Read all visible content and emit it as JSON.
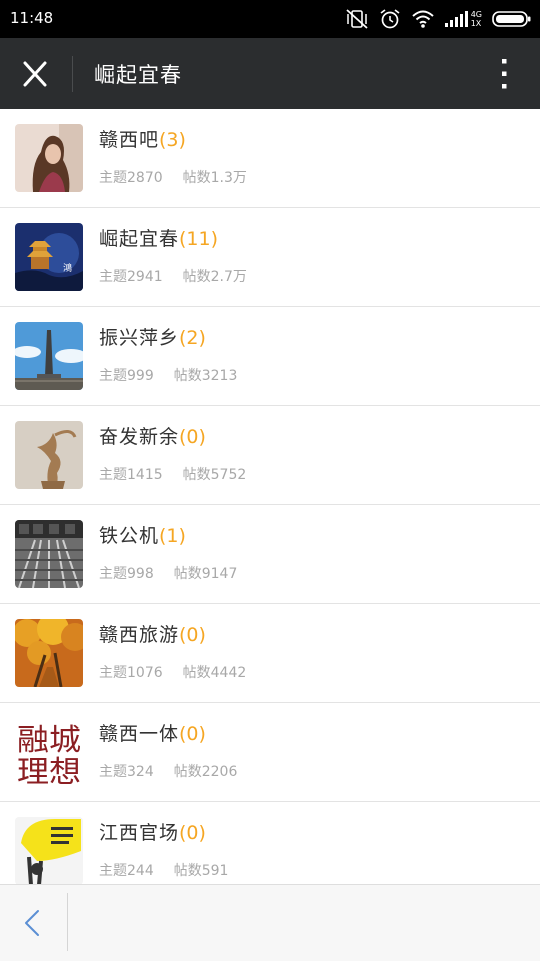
{
  "status_bar": {
    "time": "11:48",
    "network_label_top": "4G",
    "network_label_bottom": "1X",
    "icons": [
      "vibrate-mute-icon",
      "alarm-icon",
      "wifi-icon",
      "signal-icon",
      "battery-icon"
    ]
  },
  "header": {
    "title": "崛起宜春",
    "close_icon": "close-icon",
    "menu_icon": "more-vertical-icon"
  },
  "colors": {
    "title_bar": "#2b2d2f",
    "count_accent": "#f5a623",
    "meta_text": "#a8a8a8"
  },
  "forums": [
    {
      "name": "赣西吧",
      "count": "(3)",
      "topics": "主题2870",
      "posts": "帖数1.3万",
      "thumb": "portrait-photo"
    },
    {
      "name": "崛起宜春",
      "count": "(11)",
      "topics": "主题2941",
      "posts": "帖数2.7万",
      "thumb": "pavilion-night-photo"
    },
    {
      "name": "振兴萍乡",
      "count": "(2)",
      "topics": "主题999",
      "posts": "帖数3213",
      "thumb": "monument-photo"
    },
    {
      "name": "奋发新余",
      "count": "(0)",
      "topics": "主题1415",
      "posts": "帖数5752",
      "thumb": "statue-photo"
    },
    {
      "name": "铁公机",
      "count": "(1)",
      "topics": "主题998",
      "posts": "帖数9147",
      "thumb": "railway-photo"
    },
    {
      "name": "赣西旅游",
      "count": "(0)",
      "topics": "主题1076",
      "posts": "帖数4442",
      "thumb": "autumn-trees-photo"
    },
    {
      "name": "赣西一体",
      "count": "(0)",
      "topics": "主题324",
      "posts": "帖数2206",
      "thumb": "calligraphy-logo",
      "thumb_text": "融城理想"
    },
    {
      "name": "江西官场",
      "count": "(0)",
      "topics": "主题244",
      "posts": "帖数591",
      "thumb": "yellow-sign-photo"
    }
  ],
  "bottom_bar": {
    "back_icon": "back-arrow-icon"
  }
}
